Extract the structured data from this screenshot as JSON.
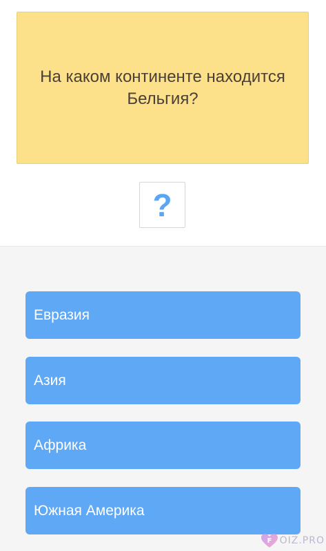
{
  "question": {
    "text": "На каком континенте находится Бельгия?"
  },
  "hint": {
    "symbol": "?",
    "icon": "question-mark-icon",
    "color": "#5aa6f2"
  },
  "answers": [
    {
      "label": "Евразия"
    },
    {
      "label": "Азия"
    },
    {
      "label": "Африка"
    },
    {
      "label": "Южная Америка"
    }
  ],
  "watermark": {
    "text": "OIZ.PRO",
    "icon": "heart-logo-icon"
  },
  "colors": {
    "question_card": "#fde08a",
    "answer_button": "#5ea8f5",
    "bottom_background": "#f5f5f5"
  }
}
